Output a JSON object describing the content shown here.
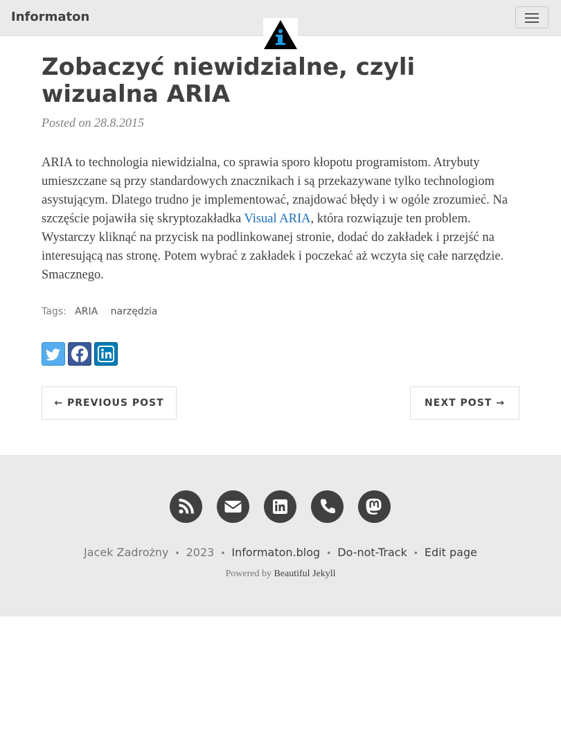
{
  "navbar": {
    "brand": "Informaton",
    "menu_icon": "hamburger-menu-icon",
    "logo_icon": "info-triangle-logo"
  },
  "post": {
    "title": "Zobaczyć niewidzialne, czyli wizualna ARIA",
    "meta": "Posted on 28.8.2015",
    "body_before_link": "ARIA to technologia niewidzialna, co sprawia sporo kłopotu programistom. Atrybuty umieszczane są przy standardowych znacznikach i są przekazywane tylko technologiom asystującym. Dlatego trudno je implementować, znajdować błędy i w ogóle zrozumieć. Na szczęście pojawiła się skryptozakładka ",
    "link_text": "Visual ARIA",
    "body_after_link": ", która rozwiązuje ten problem. Wystarczy kliknąć na przycisk na podlinkowanej stronie, dodać do zakładek i przejść na interesującą nas stronę. Potem wybrać z zakładek i poczekać aż wczyta się całe narzędzie. Smacznego.",
    "tags_label": "Tags:",
    "tags": [
      "ARIA",
      "narzędzia"
    ]
  },
  "share": {
    "icons": [
      "twitter-icon",
      "facebook-icon",
      "linkedin-icon"
    ],
    "colors": {
      "twitter": "#55acee",
      "facebook": "#3b5998",
      "linkedin": "#007bb5"
    }
  },
  "pager": {
    "previous": "← Previous Post",
    "next": "Next Post →"
  },
  "footer": {
    "social_icons": [
      "rss-icon",
      "envelope-icon",
      "linkedin-icon",
      "phone-icon",
      "mastodon-icon"
    ],
    "author": "Jacek Zadrożny",
    "year": "2023",
    "blog": "Informaton.blog",
    "dnt": "Do-not-Track",
    "edit": "Edit page",
    "dot": "•",
    "powered_label": "Powered by",
    "powered_link": "Beautiful Jekyll"
  }
}
